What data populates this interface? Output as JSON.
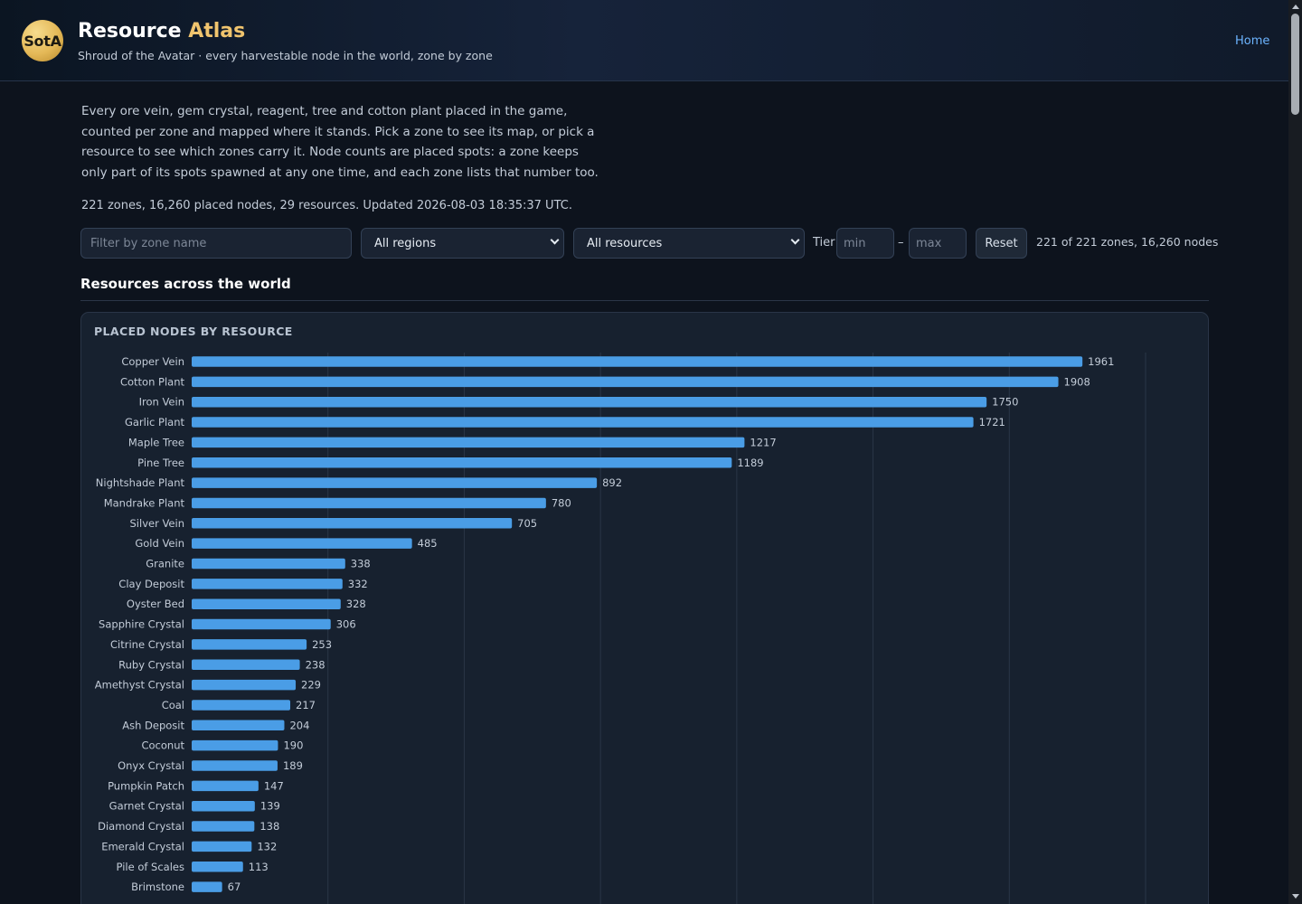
{
  "header": {
    "logo_text": "SotA",
    "title_main": "Resource",
    "title_accent": "Atlas",
    "subtitle": "Shroud of the Avatar · every harvestable node in the world, zone by zone",
    "home_link": "Home",
    "accent_color": "#f0c46e",
    "link_color": "#6cb4ff"
  },
  "intro": {
    "text": "Every ore vein, gem crystal, reagent, tree and cotton plant placed in the game, counted per zone and mapped where it stands. Pick a zone to see its map, or pick a resource to see which zones carry it. Node counts are placed spots: a zone keeps only part of its spots spawned at any one time, and each zone lists that number too.",
    "stats": "221 zones, 16,260 placed nodes, 29 resources. Updated 2026-08-03 18:35:37 UTC."
  },
  "filters": {
    "zone_placeholder": "Filter by zone name",
    "region_selected": "All regions",
    "resource_selected": "All resources",
    "tier_label": "Tier",
    "tier_min_placeholder": "min",
    "tier_dash": "–",
    "tier_max_placeholder": "max",
    "reset_label": "Reset",
    "result_count": "221 of 221 zones, 16,260 nodes"
  },
  "section": {
    "title": "Resources across the world",
    "chart_title": "PLACED NODES BY RESOURCE"
  },
  "chart_data": {
    "type": "bar",
    "orientation": "horizontal",
    "title": "PLACED NODES BY RESOURCE",
    "bar_color": "#4a9de6",
    "grid": true,
    "xlim": [
      0,
      2100
    ],
    "categories": [
      "Copper Vein",
      "Cotton Plant",
      "Iron Vein",
      "Garlic Plant",
      "Maple Tree",
      "Pine Tree",
      "Nightshade Plant",
      "Mandrake Plant",
      "Silver Vein",
      "Gold Vein",
      "Granite",
      "Clay Deposit",
      "Oyster Bed",
      "Sapphire Crystal",
      "Citrine Crystal",
      "Ruby Crystal",
      "Amethyst Crystal",
      "Coal",
      "Ash Deposit",
      "Coconut",
      "Onyx Crystal",
      "Pumpkin Patch",
      "Garnet Crystal",
      "Diamond Crystal",
      "Emerald Crystal",
      "Pile of Scales",
      "Brimstone"
    ],
    "values": [
      1961,
      1908,
      1750,
      1721,
      1217,
      1189,
      892,
      780,
      705,
      485,
      338,
      332,
      328,
      306,
      253,
      238,
      229,
      217,
      204,
      190,
      189,
      147,
      139,
      138,
      132,
      113,
      67
    ]
  }
}
